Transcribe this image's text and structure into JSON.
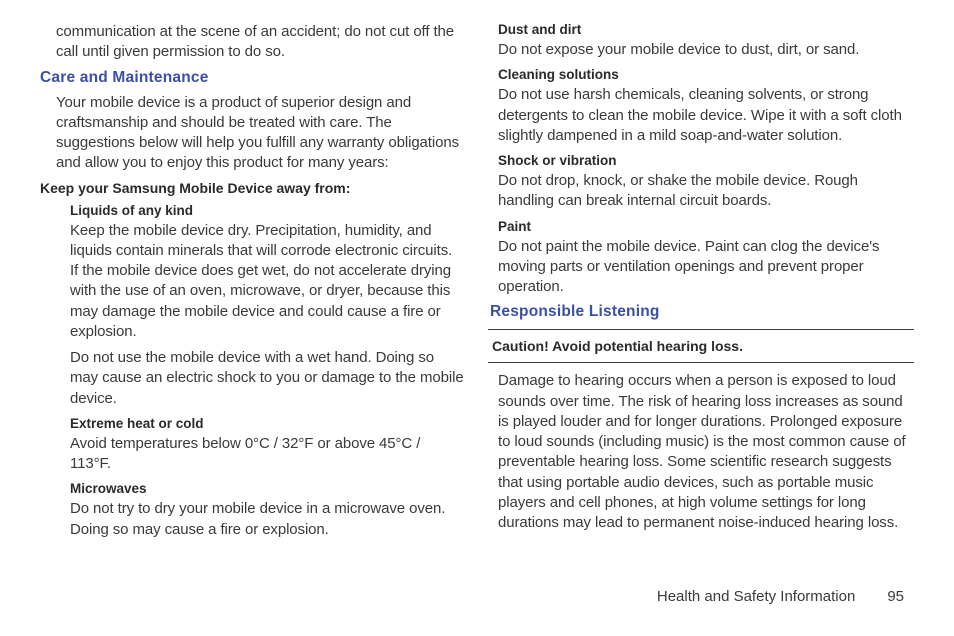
{
  "left": {
    "intro_continuation": "communication at the scene of an accident; do not cut off the call until given permission to do so.",
    "care_heading": "Care and Maintenance",
    "care_intro": "Your mobile device is a product of superior design and craftsmanship and should be treated with care. The suggestions below will help you fulfill any warranty obligations and allow you to enjoy this product for many years:",
    "keep_away_heading": "Keep your Samsung Mobile Device away from:",
    "liquids_heading": "Liquids of any kind",
    "liquids_p1": "Keep the mobile device dry. Precipitation, humidity, and liquids contain minerals that will corrode electronic circuits. If the mobile device does get wet, do not accelerate drying with the use of an oven, microwave, or dryer, because this may damage the mobile device and could cause a fire or explosion.",
    "liquids_p2": "Do not use the mobile device with a wet hand. Doing so may cause an electric shock to you or damage to the mobile device.",
    "heat_heading": "Extreme heat or cold",
    "heat_body": "Avoid temperatures below 0°C / 32°F or above 45°C / 113°F.",
    "microwaves_heading": "Microwaves",
    "microwaves_body": "Do not try to dry your mobile device in a microwave oven. Doing so may cause a fire or explosion."
  },
  "right": {
    "dust_heading": "Dust and dirt",
    "dust_body": "Do not expose your mobile device to dust, dirt, or sand.",
    "cleaning_heading": "Cleaning solutions",
    "cleaning_body": "Do not use harsh chemicals, cleaning solvents, or strong detergents to clean the mobile device. Wipe it with a soft cloth slightly dampened in a mild soap-and-water solution.",
    "shock_heading": "Shock or vibration",
    "shock_body": "Do not drop, knock, or shake the mobile device. Rough handling can break internal circuit boards.",
    "paint_heading": "Paint",
    "paint_body": "Do not paint the mobile device. Paint can clog the device's moving parts or ventilation openings and prevent proper operation.",
    "listening_heading": "Responsible Listening",
    "caution": "Caution! Avoid potential hearing loss.",
    "listening_body": "Damage to hearing occurs when a person is exposed to loud sounds over time. The risk of hearing loss increases as sound is played louder and for longer durations. Prolonged exposure to loud sounds (including music) is the most common cause of preventable hearing loss. Some scientific research suggests that using portable audio devices, such as portable music players and cell phones, at high volume settings for long durations may lead to permanent noise-induced hearing loss."
  },
  "footer": {
    "section": "Health and Safety Information",
    "page": "95"
  }
}
